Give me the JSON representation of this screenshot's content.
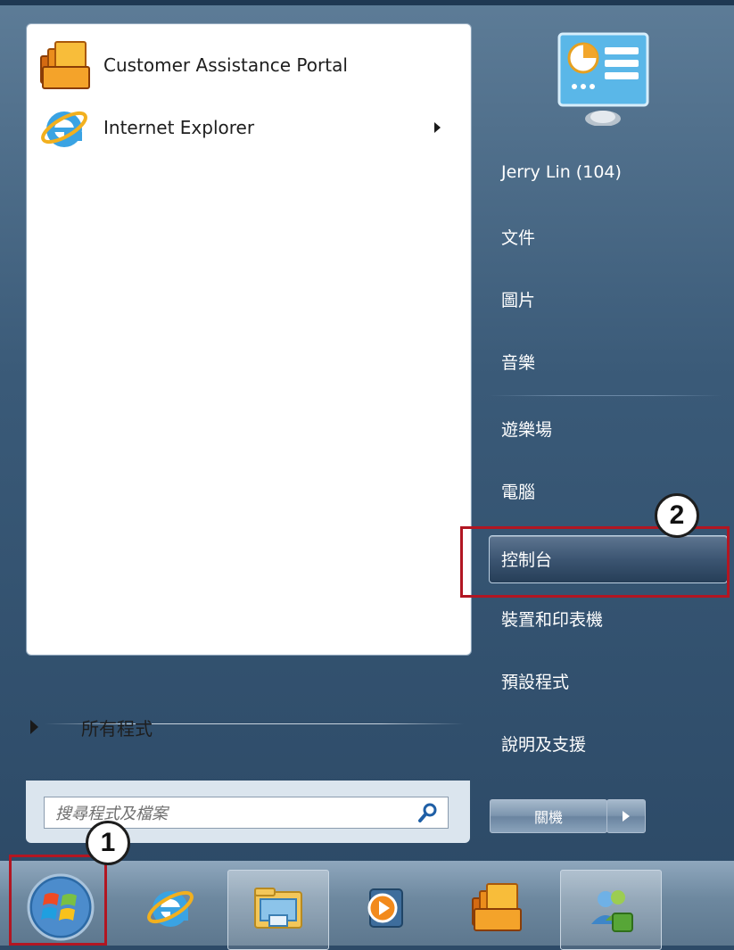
{
  "start_menu": {
    "pinned": [
      {
        "label": "Customer Assistance Portal",
        "icon": "customer-portal-icon",
        "has_submenu": false
      },
      {
        "label": "Internet Explorer",
        "icon": "internet-explorer-icon",
        "has_submenu": true
      }
    ],
    "all_programs_label": "所有程式",
    "search_placeholder": "搜尋程式及檔案"
  },
  "right_panel": {
    "user_tile_icon": "user-picture-icon",
    "items": [
      {
        "label": "Jerry Lin (104)"
      },
      {
        "label": "文件"
      },
      {
        "label": "圖片"
      },
      {
        "label": "音樂"
      },
      {
        "label": "遊樂場"
      },
      {
        "label": "電腦"
      },
      {
        "label": "控制台",
        "highlighted": true
      },
      {
        "label": "裝置和印表機"
      },
      {
        "label": "預設程式"
      },
      {
        "label": "說明及支援"
      }
    ],
    "shutdown_label": "關機"
  },
  "annotations": {
    "step1": "1",
    "step2": "2",
    "highlight_color": "#b21622"
  },
  "taskbar": {
    "buttons": [
      {
        "icon": "windows-start-orb-icon"
      },
      {
        "icon": "internet-explorer-icon"
      },
      {
        "icon": "file-explorer-folder-icon"
      },
      {
        "icon": "media-player-icon"
      },
      {
        "icon": "customer-portal-icon"
      },
      {
        "icon": "windows-live-messenger-icon"
      }
    ]
  }
}
